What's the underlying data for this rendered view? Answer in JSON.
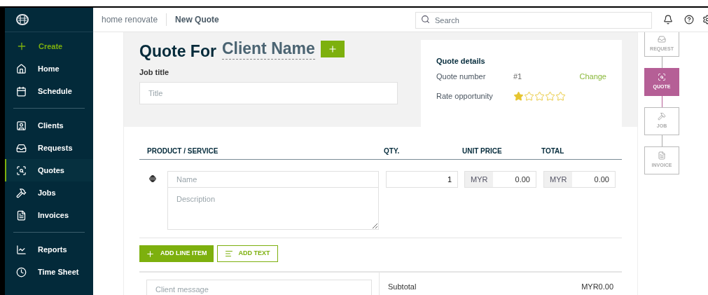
{
  "sidebar": {
    "create": "Create",
    "groups": [
      [
        {
          "label": "Home",
          "selected": false
        },
        {
          "label": "Schedule",
          "selected": false
        }
      ],
      [
        {
          "label": "Clients",
          "selected": false
        },
        {
          "label": "Requests",
          "selected": false
        },
        {
          "label": "Quotes",
          "selected": true
        },
        {
          "label": "Jobs",
          "selected": false
        },
        {
          "label": "Invoices",
          "selected": false
        }
      ],
      [
        {
          "label": "Reports",
          "selected": false
        },
        {
          "label": "Time Sheet",
          "selected": false
        }
      ]
    ]
  },
  "topbar": {
    "breadcrumb": "home renovate",
    "page": "New Quote",
    "search": {
      "placeholder": "Search"
    }
  },
  "header": {
    "title": "Quote For",
    "client": "Client Name",
    "job_title_label": "Job title",
    "job_title": {
      "placeholder": "Title"
    }
  },
  "quote_details": {
    "heading": "Quote details",
    "number_label": "Quote number",
    "number": "#1",
    "change": "Change",
    "rate_label": "Rate opportunity",
    "stars": 1
  },
  "table": {
    "columns": [
      "PRODUCT / SERVICE",
      "QTY.",
      "UNIT PRICE",
      "TOTAL"
    ],
    "rows": [
      {
        "name": {
          "placeholder": "Name"
        },
        "description": {
          "placeholder": "Description"
        },
        "qty": "1",
        "unit_currency": "MYR",
        "unit_price": "0.00",
        "total_currency": "MYR",
        "total": "0.00"
      }
    ]
  },
  "actions": {
    "add_line_item": "ADD LINE ITEM",
    "add_text": "ADD TEXT"
  },
  "footer": {
    "client_message": {
      "placeholder": "Client message"
    },
    "subtotal_label": "Subtotal",
    "subtotal": "MYR0.00"
  },
  "workflow": [
    {
      "label": "REQUEST",
      "selected": false
    },
    {
      "label": "QUOTE",
      "selected": true
    },
    {
      "label": "JOB",
      "selected": false
    },
    {
      "label": "INVOICE",
      "selected": false
    }
  ]
}
